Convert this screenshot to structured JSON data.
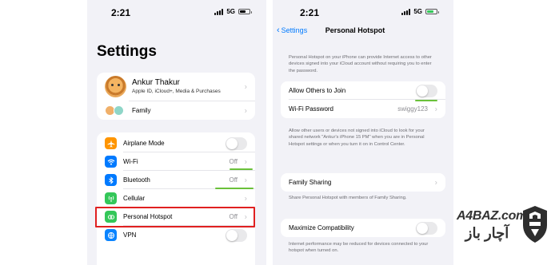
{
  "left": {
    "status": {
      "time": "2:21",
      "network": "5G"
    },
    "title": "Settings",
    "profile": {
      "name": "Ankur Thakur",
      "subtitle": "Apple ID, iCloud+, Media & Purchases",
      "family_label": "Family"
    },
    "items": [
      {
        "label": "Airplane Mode",
        "value": "",
        "icon": "airplane-icon",
        "color": "#ff9500",
        "toggle": true
      },
      {
        "label": "Wi-Fi",
        "value": "Off",
        "icon": "wifi-icon",
        "color": "#007aff",
        "toggle": false
      },
      {
        "label": "Bluetooth",
        "value": "Off",
        "icon": "bluetooth-icon",
        "color": "#007aff",
        "toggle": false
      },
      {
        "label": "Cellular",
        "value": "",
        "icon": "cellular-icon",
        "color": "#34c759",
        "toggle": false
      },
      {
        "label": "Personal Hotspot",
        "value": "Off",
        "icon": "hotspot-icon",
        "color": "#34c759",
        "toggle": false
      },
      {
        "label": "VPN",
        "value": "",
        "icon": "vpn-icon",
        "color": "#0a84ff",
        "toggle": true
      }
    ]
  },
  "right": {
    "status": {
      "time": "2:21",
      "network": "5G"
    },
    "nav": {
      "back_label": "Settings",
      "title": "Personal Hotspot"
    },
    "intro": "Personal Hotspot on your iPhone can provide Internet access to other devices signed into your iCloud account without requiring you to enter the password.",
    "allow_label": "Allow Others to Join",
    "wifi_password_label": "Wi-Fi Password",
    "wifi_password_value": "swiggy123",
    "join_note": "Allow other users or devices not signed into iCloud to look for your shared network \"Ankur's iPhone 15 PM\" when you are in Personal Hotspot settings or when you turn it on in Control Center.",
    "family_sharing_label": "Family Sharing",
    "family_note": "Share Personal Hotspot with members of Family Sharing.",
    "max_compat_label": "Maximize Compatibility",
    "compat_note": "Internet performance may be reduced for devices connected to your hotspot when turned on."
  },
  "watermark": {
    "latin": "A4BAZ.com",
    "persian": "آچار باز"
  }
}
